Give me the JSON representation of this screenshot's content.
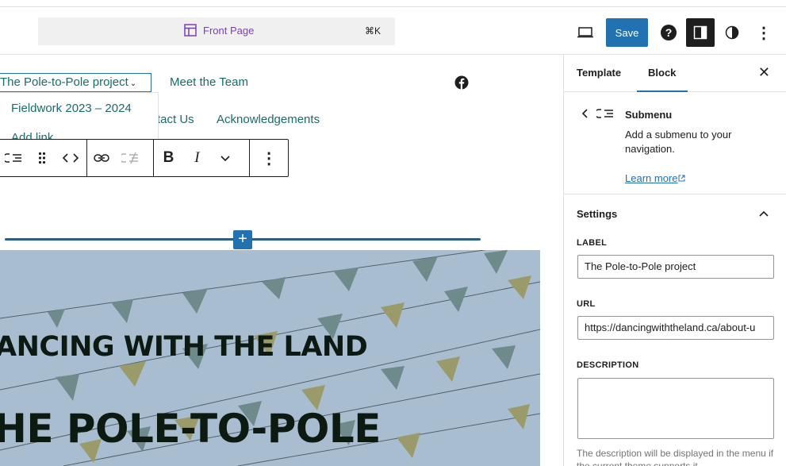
{
  "topbar": {
    "page_title": "Front Page",
    "shortcut": "⌘K",
    "save_label": "Save",
    "help_icon": "?",
    "more_icon": "⋮"
  },
  "canvas": {
    "nav": {
      "items": [
        {
          "label": "The Pole-to-Pole project"
        },
        {
          "label": "Meet the Team"
        },
        {
          "label": "tact Us"
        },
        {
          "label": "Acknowledgements"
        }
      ],
      "submenu": [
        {
          "label": "Fieldwork 2023 – 2024"
        },
        {
          "label": "Add link"
        }
      ]
    },
    "toolbar": {
      "bold": "B",
      "italic": "I"
    },
    "inserter": "+",
    "cover": {
      "heading1": "ANCING WITH THE LAND",
      "heading2": "HE POLE-TO-POLE"
    }
  },
  "sidebar": {
    "tabs": [
      {
        "label": "Template"
      },
      {
        "label": "Block"
      }
    ],
    "close_icon": "✕",
    "block": {
      "title": "Submenu",
      "description": "Add a submenu to your navigation.",
      "learn_more": "Learn more"
    },
    "settings": {
      "title": "Settings",
      "label_field": "LABEL",
      "label_value": "The Pole-to-Pole project",
      "url_field": "URL",
      "url_value": "https://dancingwiththeland.ca/about-u",
      "description_field": "DESCRIPTION",
      "description_value": "",
      "help_text": "The description will be displayed in the menu if the current theme supports it."
    }
  },
  "colors": {
    "accent": "#2271b1",
    "link_text": "#1b6b6b",
    "cover_bg": "#a9bdd0",
    "page_title": "#7b3fb5"
  },
  "icons": [
    "layout-icon",
    "desktop-preview-icon",
    "help-icon",
    "settings-sidebar-icon",
    "styles-contrast-icon",
    "options-icon",
    "facebook-icon",
    "submenu-icon",
    "drag-handle-icon",
    "move-arrows-icon",
    "link-icon",
    "unlink-submenu-icon",
    "chevron-down-icon",
    "chevron-left-icon",
    "chevron-up-icon",
    "close-icon",
    "external-link-icon"
  ]
}
